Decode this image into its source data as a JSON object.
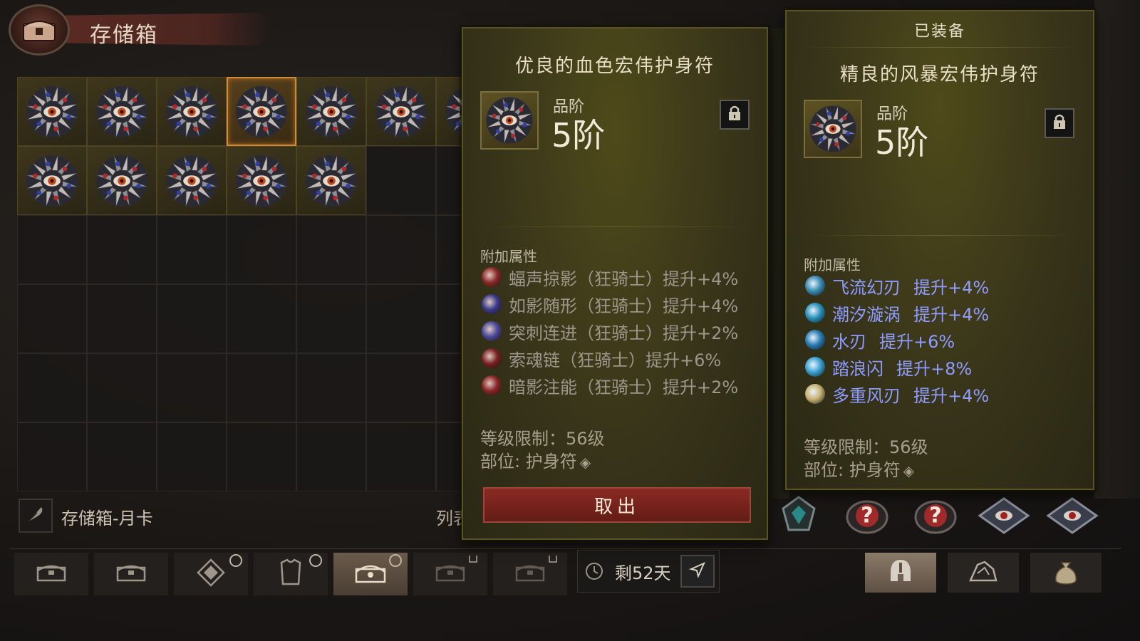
{
  "stash": {
    "title": "存储箱",
    "footer_name": "存储箱-月卡",
    "list_label": "列表",
    "grid": {
      "columns": 7,
      "rows": 6,
      "filled_slots": [
        0,
        1,
        2,
        3,
        4,
        5,
        6,
        7,
        8,
        9,
        10,
        11
      ],
      "selected_slot": 3,
      "item_icon": "amulet-eye-icon"
    }
  },
  "tabs": [
    {
      "icon": "chest-icon",
      "active": false,
      "badge": "none"
    },
    {
      "icon": "chest-icon",
      "active": false,
      "badge": "none"
    },
    {
      "icon": "gem-icon",
      "active": false,
      "badge": "clock"
    },
    {
      "icon": "armor-icon",
      "active": false,
      "badge": "clock"
    },
    {
      "icon": "ornate-chest-icon",
      "active": true,
      "badge": "clock"
    },
    {
      "icon": "chest-icon",
      "active": false,
      "badge": "lock"
    },
    {
      "icon": "chest-icon",
      "active": false,
      "badge": "lock"
    }
  ],
  "timer": {
    "text": "剩52天",
    "icon": "clock-icon",
    "send_icon": "send-icon"
  },
  "right_tabs": [
    {
      "icon": "helmet-icon",
      "active": true
    },
    {
      "icon": "material-icon",
      "active": false
    },
    {
      "icon": "bag-icon",
      "active": false
    }
  ],
  "equip_slots": [
    {
      "icon": "gem-slot-icon"
    },
    {
      "icon": "unknown-slot-icon",
      "text": "?"
    },
    {
      "icon": "unknown-slot-icon",
      "text": "?"
    },
    {
      "icon": "amulet-slot-icon"
    },
    {
      "icon": "amulet-slot-icon"
    }
  ],
  "tooltip_left": {
    "title": "优良的血色宏伟护身符",
    "quality_label": "品阶",
    "quality_value": "5阶",
    "affix_header": "附加属性",
    "affixes": [
      {
        "text": "蝠声掠影（狂骑士）提升+4%",
        "icon_color": "#8a2a28"
      },
      {
        "text": "如影随形（狂骑士）提升+4%",
        "icon_color": "#3a3a8a"
      },
      {
        "text": "突刺连进（狂骑士）提升+2%",
        "icon_color": "#4a4a9a"
      },
      {
        "text": "索魂链（狂骑士）提升+6%",
        "icon_color": "#7a2222"
      },
      {
        "text": "暗影注能（狂骑士）提升+2%",
        "icon_color": "#8a2626"
      }
    ],
    "level_req": "等级限制：56级",
    "slot_req": "部位: 护身符",
    "action": "取出"
  },
  "tooltip_right": {
    "equipped_label": "已装备",
    "title": "精良的风暴宏伟护身符",
    "quality_label": "品阶",
    "quality_value": "5阶",
    "affix_header": "附加属性",
    "affixes": [
      {
        "name": "飞流幻刃",
        "value": "提升+4%",
        "icon_color": "#3a8ab0"
      },
      {
        "name": "潮汐漩涡",
        "value": "提升+4%",
        "icon_color": "#2a90b8"
      },
      {
        "name": "水刃",
        "value": "提升+6%",
        "icon_color": "#2a7ab0"
      },
      {
        "name": "踏浪闪",
        "value": "提升+8%",
        "icon_color": "#3aa0d0"
      },
      {
        "name": "多重风刃",
        "value": "提升+4%",
        "icon_color": "#c8b070"
      }
    ],
    "level_req": "等级限制：56级",
    "slot_req": "部位: 护身符"
  },
  "colors": {
    "accent_selected": "#d08a3a",
    "affix_magic": "#8e9cff",
    "button_red": "#8a2a22"
  }
}
